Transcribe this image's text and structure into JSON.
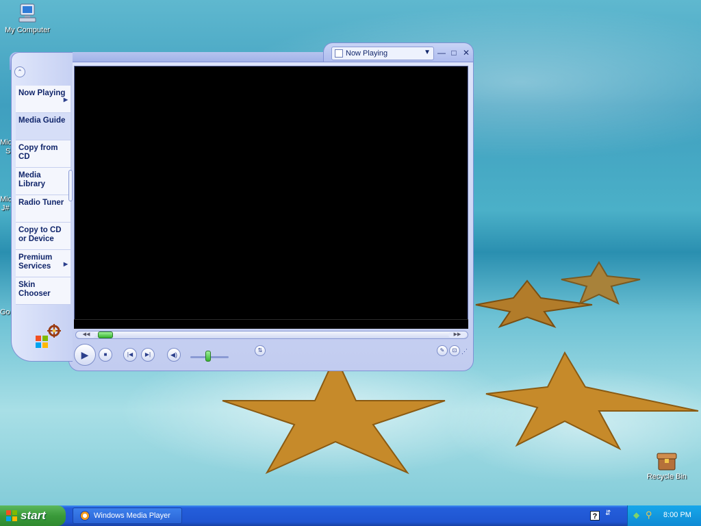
{
  "desktop": {
    "icons": [
      {
        "label": "My Computer",
        "icon": "my-computer-icon"
      },
      {
        "label": "Recycle Bin",
        "icon": "recycle-bin-icon"
      }
    ],
    "partial_labels": [
      "Mic",
      "S",
      "Mic",
      "J#",
      "Go"
    ]
  },
  "wmp": {
    "title_dropdown": "Now Playing",
    "taskpane": [
      {
        "label": "Now Playing",
        "has_arrow": true
      },
      {
        "label": "Media Guide",
        "has_arrow": false
      },
      {
        "label": "Copy from CD",
        "has_arrow": false
      },
      {
        "label": "Media Library",
        "has_arrow": false
      },
      {
        "label": "Radio Tuner",
        "has_arrow": false
      },
      {
        "label": "Copy to CD or Device",
        "has_arrow": false
      },
      {
        "label": "Premium Services",
        "has_arrow": true
      },
      {
        "label": "Skin Chooser",
        "has_arrow": false
      }
    ],
    "window_buttons": {
      "minimize": "—",
      "maximize": "□",
      "close": "✕"
    },
    "seek_left": "◀◀",
    "seek_right": "▶▶"
  },
  "taskbar": {
    "start_label": "start",
    "task": "Windows Media Player",
    "clock": "8:00 PM"
  },
  "colors": {
    "taskbar_blue": "#245edb",
    "start_green": "#3a9a3a",
    "wmp_frame": "#c2ccf0"
  }
}
